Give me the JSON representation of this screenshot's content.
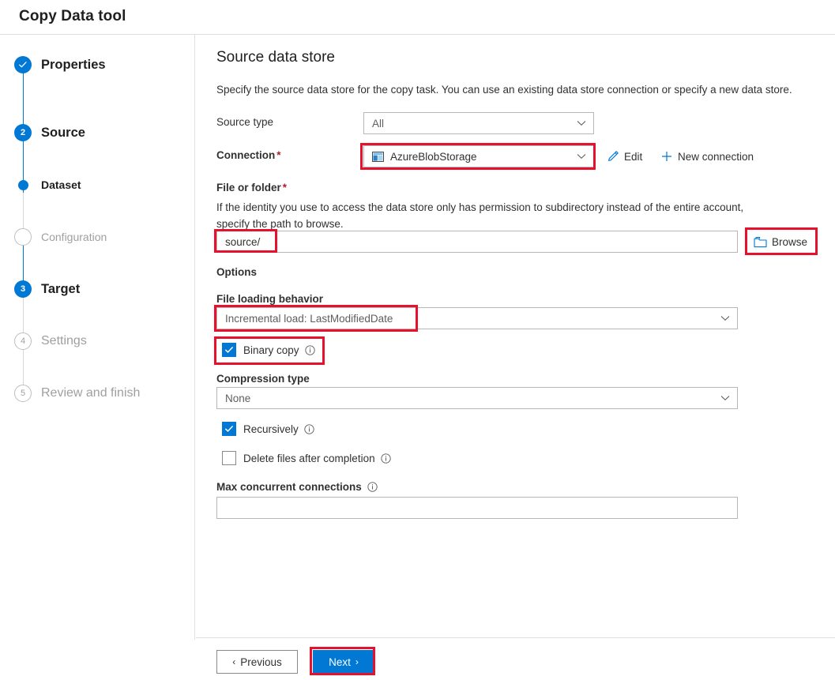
{
  "window": {
    "title": "Copy Data tool"
  },
  "sidebar": {
    "steps": [
      {
        "label": "Properties",
        "marker": "check",
        "state": "completed"
      },
      {
        "label": "Source",
        "marker": "2",
        "state": "active"
      },
      {
        "label": "Dataset",
        "marker": "dot",
        "state": "active-sub"
      },
      {
        "label": "Configuration",
        "marker": "hollow",
        "state": "disabled-sub"
      },
      {
        "label": "Target",
        "marker": "3",
        "state": "active"
      },
      {
        "label": "Settings",
        "marker": "4",
        "state": "disabled"
      },
      {
        "label": "Review and finish",
        "marker": "5",
        "state": "disabled"
      }
    ]
  },
  "main": {
    "title": "Source data store",
    "description": "Specify the source data store for the copy task. You can use an existing data store connection or specify a new data store.",
    "source_type": {
      "label": "Source type",
      "value": "All"
    },
    "connection": {
      "label": "Connection",
      "required_mark": "*",
      "value": "AzureBlobStorage",
      "icon": "azure-blob-storage-icon",
      "edit_label": "Edit",
      "new_connection_label": "New connection"
    },
    "file_or_folder": {
      "label": "File or folder",
      "required_mark": "*",
      "helper": "If the identity you use to access the data store only has permission to subdirectory instead of the entire account, specify the path to browse.",
      "value": "source/",
      "browse_label": "Browse"
    },
    "options": {
      "heading": "Options",
      "file_loading_behavior": {
        "label": "File loading behavior",
        "value": "Incremental load: LastModifiedDate"
      },
      "binary_copy": {
        "label": "Binary copy",
        "checked": true,
        "info": "info-icon"
      },
      "compression_type": {
        "label": "Compression type",
        "value": "None"
      },
      "recursively": {
        "label": "Recursively",
        "checked": true,
        "info": "info-icon"
      },
      "delete_files": {
        "label": "Delete files after completion",
        "checked": false,
        "info": "info-icon"
      },
      "max_concurrent_connections": {
        "label": "Max concurrent connections",
        "value": "",
        "info": "info-icon"
      }
    }
  },
  "footer": {
    "previous_label": "Previous",
    "next_label": "Next",
    "previous_chevron": "‹",
    "next_chevron": "›"
  },
  "colors": {
    "accent": "#0078d4",
    "annotation": "#e8112d",
    "required": "#a4262c",
    "disabled_text": "#a19f9d",
    "border": "#b7b7b7"
  }
}
